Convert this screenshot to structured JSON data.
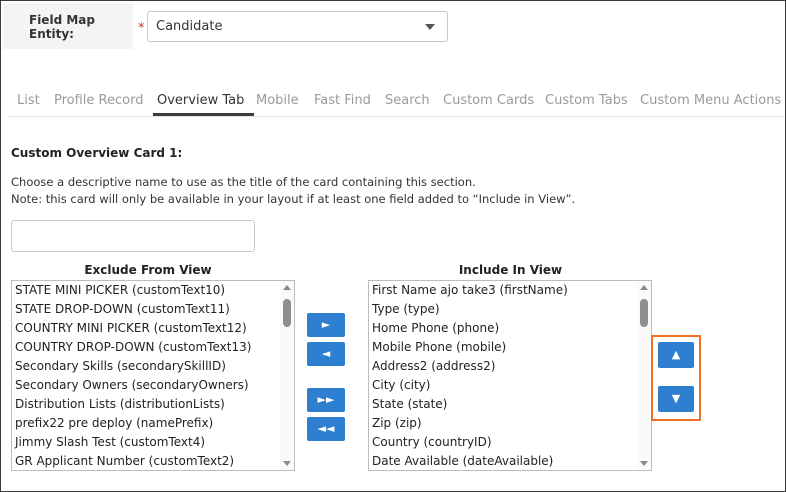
{
  "entity": {
    "label": "Field Map Entity:",
    "required_marker": "*",
    "selected": "Candidate"
  },
  "tabs": [
    {
      "label": "List"
    },
    {
      "label": "Profile Record"
    },
    {
      "label": "Overview Tab",
      "active": true
    },
    {
      "label": "Mobile"
    },
    {
      "label": "Fast Find"
    },
    {
      "label": "Search"
    },
    {
      "label": "Custom Cards"
    },
    {
      "label": "Custom Tabs"
    },
    {
      "label": "Custom Menu Actions"
    }
  ],
  "section": {
    "title": "Custom Overview Card 1:",
    "description_line1": "Choose a descriptive name to use as the title of the card containing this section.",
    "description_line2": "Note: this card will only be available in your layout if at least one field added to “Include in View”.",
    "title_value": ""
  },
  "exclude": {
    "heading": "Exclude From View",
    "items": [
      "STATE MINI PICKER (customText10)",
      "STATE DROP-DOWN (customText11)",
      "COUNTRY MINI PICKER (customText12)",
      "COUNTRY DROP-DOWN (customText13)",
      "Secondary Skills (secondarySkillID)",
      "Secondary Owners (secondaryOwners)",
      "Distribution Lists (distributionLists)",
      "prefix22 pre deploy (namePrefix)",
      "Jimmy Slash Test (customText4)",
      "GR Applicant Number (customText2)"
    ]
  },
  "include": {
    "heading": "Include In View",
    "items": [
      "First Name ajo take3 (firstName)",
      "Type (type)",
      "Home Phone (phone)",
      "Mobile Phone (mobile)",
      "Address2 (address2)",
      "City (city)",
      "State (state)",
      "Zip (zip)",
      "Country (countryID)",
      "Date Available (dateAvailable)"
    ]
  },
  "move_buttons": {
    "add": "►",
    "remove": "◄",
    "add_all": "►►",
    "remove_all": "◄◄"
  },
  "order_buttons": {
    "up": "▲",
    "down": "▼"
  },
  "colors": {
    "accent": "#2f7fd0",
    "highlight": "#f07021",
    "required": "#e0301e"
  }
}
